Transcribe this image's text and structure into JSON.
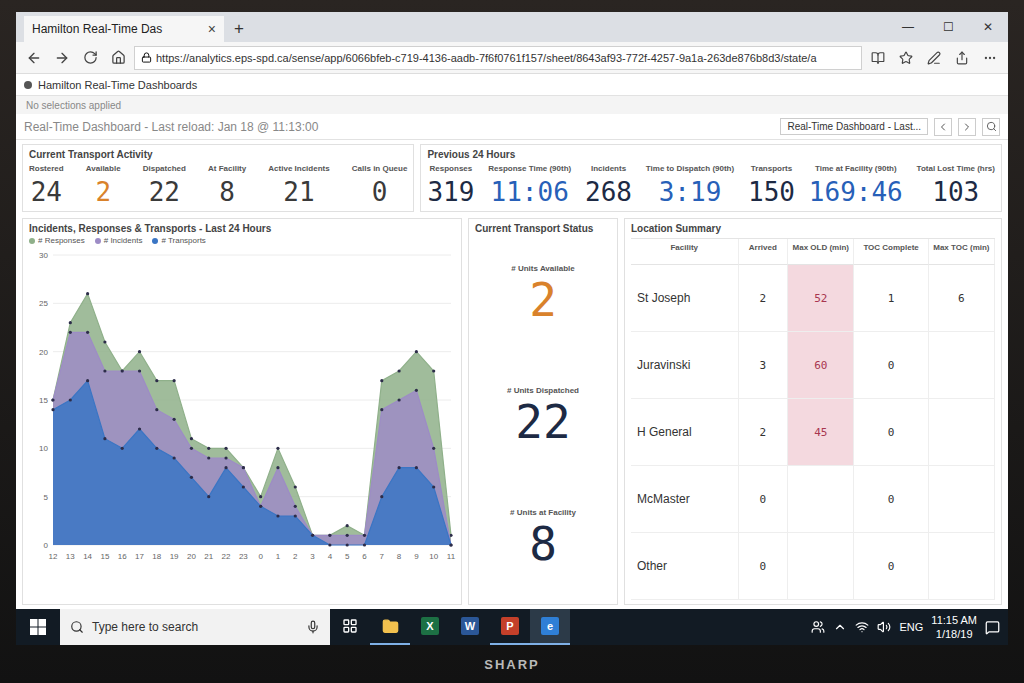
{
  "browser": {
    "tab": {
      "title": "Hamilton Real-Time Das",
      "close": "×"
    },
    "new_tab": "+",
    "window_controls": [
      "—",
      "☐",
      "✕"
    ],
    "url": "https://analytics.eps-spd.ca/sense/app/6066bfeb-c719-4136-aadb-7f6f0761f157/sheet/8643af93-772f-4257-9a1a-263de876b8d3/state/a",
    "app_tab": "Hamilton Real-Time Dashboards",
    "selections": "No selections applied"
  },
  "sheet": {
    "title": "Real-Time Dashboard - Last reload: Jan 18 @ 11:13:00",
    "sheet_select": "Real-Time Dashboard - Last..."
  },
  "current_activity": {
    "title": "Current Transport Activity",
    "kpis": [
      {
        "label": "Rostered",
        "value": "24",
        "color": "#3a3a3a"
      },
      {
        "label": "Available",
        "value": "2",
        "color": "#d9822b"
      },
      {
        "label": "Dispatched",
        "value": "22",
        "color": "#3a3a3a"
      },
      {
        "label": "At Facility",
        "value": "8",
        "color": "#3a3a3a"
      },
      {
        "label": "Active Incidents",
        "value": "21",
        "color": "#3a3a3a"
      },
      {
        "label": "Calls in Queue",
        "value": "0",
        "color": "#3a3a3a"
      }
    ]
  },
  "previous_24h": {
    "title": "Previous 24 Hours",
    "kpis": [
      {
        "label": "Responses",
        "value": "319",
        "color": "#1d2a44"
      },
      {
        "label": "Response Time (90th)",
        "value": "11:06",
        "color": "#2760b8"
      },
      {
        "label": "Incidents",
        "value": "268",
        "color": "#1d2a44"
      },
      {
        "label": "Time to Dispatch (90th)",
        "value": "3:19",
        "color": "#2760b8"
      },
      {
        "label": "Transports",
        "value": "150",
        "color": "#1d2a44"
      },
      {
        "label": "Time at Facility (90th)",
        "value": "169:46",
        "color": "#2760b8"
      },
      {
        "label": "Total Lost Time (hrs)",
        "value": "103",
        "color": "#1d2a44"
      }
    ]
  },
  "chart": {
    "title": "Incidents, Responses & Transports - Last 24 Hours",
    "y_max": 30,
    "y_ticks": [
      "30",
      "25",
      "20",
      "15",
      "10",
      "5",
      "0"
    ],
    "x_ticks": [
      "12",
      "13",
      "14",
      "15",
      "16",
      "17",
      "18",
      "19",
      "20",
      "21",
      "22",
      "23",
      "0",
      "1",
      "2",
      "3",
      "4",
      "5",
      "6",
      "7",
      "8",
      "9",
      "10",
      "11"
    ],
    "series": [
      {
        "name": "# Responses",
        "color": "#8fb08a",
        "values": [
          15,
          23,
          26,
          21,
          18,
          20,
          17,
          17,
          11,
          10,
          10,
          8,
          5,
          10,
          6,
          1,
          1,
          2,
          1,
          17,
          18,
          20,
          18,
          1
        ]
      },
      {
        "name": "# Incidents",
        "color": "#9d8cc6",
        "values": [
          15,
          22,
          22,
          18,
          18,
          18,
          14,
          13,
          10,
          9,
          9,
          8,
          4,
          8,
          4,
          1,
          1,
          1,
          1,
          14,
          15,
          16,
          10,
          0
        ]
      },
      {
        "name": "# Transports",
        "color": "#3a75c4",
        "values": [
          14,
          15,
          17,
          11,
          10,
          12,
          10,
          9,
          7,
          5,
          8,
          6,
          4,
          3,
          3,
          1,
          0,
          0,
          0,
          5,
          8,
          8,
          6,
          0
        ]
      }
    ]
  },
  "transport_status": {
    "title": "Current Transport Status",
    "items": [
      {
        "label": "# Units Available",
        "value": "2",
        "color": "#d9822b"
      },
      {
        "label": "# Units Dispatched",
        "value": "22",
        "color": "#1d2a44"
      },
      {
        "label": "# Units at Facility",
        "value": "8",
        "color": "#1d2a44"
      }
    ]
  },
  "location_summary": {
    "title": "Location Summary",
    "columns": [
      "Facility",
      "Arrived",
      "Max OLD (min)",
      "TOC Complete",
      "Max TOC (min)"
    ],
    "rows": [
      {
        "facility": "St Joseph",
        "arrived": "2",
        "max_old": "52",
        "toc_complete": "1",
        "max_toc": "6",
        "highlighted": true
      },
      {
        "facility": "Juravinski",
        "arrived": "3",
        "max_old": "60",
        "toc_complete": "0",
        "max_toc": "",
        "highlighted": true
      },
      {
        "facility": "H General",
        "arrived": "2",
        "max_old": "45",
        "toc_complete": "0",
        "max_toc": "",
        "highlighted": true
      },
      {
        "facility": "McMaster",
        "arrived": "0",
        "max_old": "",
        "toc_complete": "0",
        "max_toc": "",
        "highlighted": false
      },
      {
        "facility": "Other",
        "arrived": "0",
        "max_old": "",
        "toc_complete": "0",
        "max_toc": "",
        "highlighted": false
      }
    ]
  },
  "taskbar": {
    "search_placeholder": "Type here to search",
    "apps": [
      {
        "letter": "X",
        "color": "#1d7044",
        "running": false,
        "selected": false
      },
      {
        "letter": "W",
        "color": "#2b5797",
        "running": false,
        "selected": false
      },
      {
        "letter": "P",
        "color": "#c4402a",
        "running": true,
        "selected": false
      },
      {
        "letter": "e",
        "color": "#2f7fd6",
        "running": true,
        "selected": true
      }
    ],
    "language": "ENG",
    "time": "11:15 AM",
    "date": "1/18/19"
  },
  "monitor": {
    "brand": "SHARP"
  }
}
